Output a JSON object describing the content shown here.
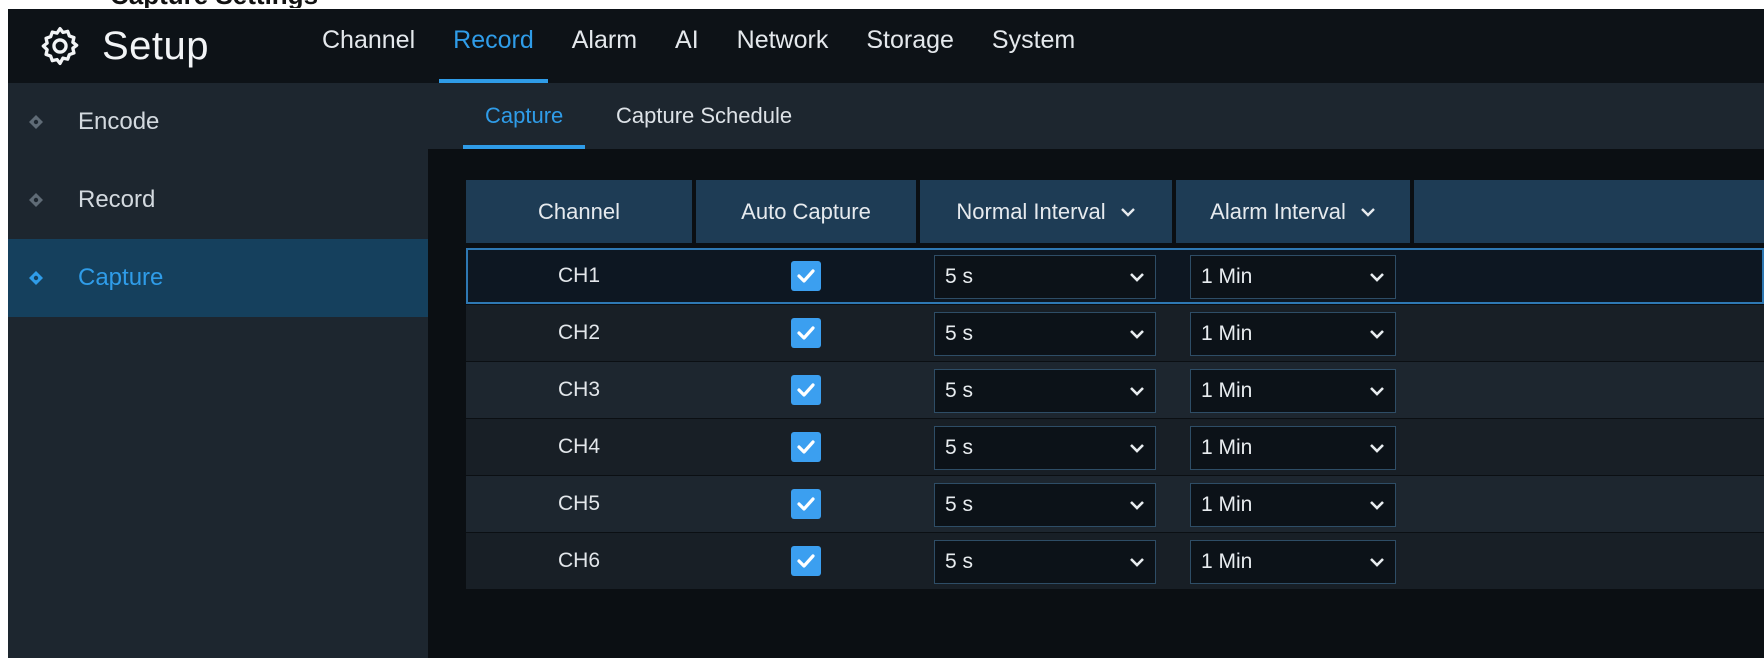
{
  "page_heading_fragment": "Capture Settings",
  "header": {
    "title": "Setup",
    "tabs": [
      {
        "label": "Channel",
        "active": false
      },
      {
        "label": "Record",
        "active": true
      },
      {
        "label": "Alarm",
        "active": false
      },
      {
        "label": "AI",
        "active": false
      },
      {
        "label": "Network",
        "active": false
      },
      {
        "label": "Storage",
        "active": false
      },
      {
        "label": "System",
        "active": false
      }
    ]
  },
  "sidebar": {
    "items": [
      {
        "label": "Encode",
        "active": false
      },
      {
        "label": "Record",
        "active": false
      },
      {
        "label": "Capture",
        "active": true
      }
    ]
  },
  "subtabs": [
    {
      "label": "Capture",
      "active": true
    },
    {
      "label": "Capture Schedule",
      "active": false
    }
  ],
  "table": {
    "columns": {
      "channel": "Channel",
      "auto_capture": "Auto Capture",
      "normal_interval": "Normal Interval",
      "alarm_interval": "Alarm Interval"
    },
    "rows": [
      {
        "channel": "CH1",
        "auto_capture": true,
        "normal_interval": "5 s",
        "alarm_interval": "1 Min"
      },
      {
        "channel": "CH2",
        "auto_capture": true,
        "normal_interval": "5 s",
        "alarm_interval": "1 Min"
      },
      {
        "channel": "CH3",
        "auto_capture": true,
        "normal_interval": "5 s",
        "alarm_interval": "1 Min"
      },
      {
        "channel": "CH4",
        "auto_capture": true,
        "normal_interval": "5 s",
        "alarm_interval": "1 Min"
      },
      {
        "channel": "CH5",
        "auto_capture": true,
        "normal_interval": "5 s",
        "alarm_interval": "1 Min"
      },
      {
        "channel": "CH6",
        "auto_capture": true,
        "normal_interval": "5 s",
        "alarm_interval": "1 Min"
      }
    ]
  },
  "colors": {
    "accent": "#2f9ce8",
    "topbar": "#0d1217",
    "sidebar": "#1d262f",
    "header_cell": "#1e3c55",
    "checkbox": "#3b9ff0"
  }
}
